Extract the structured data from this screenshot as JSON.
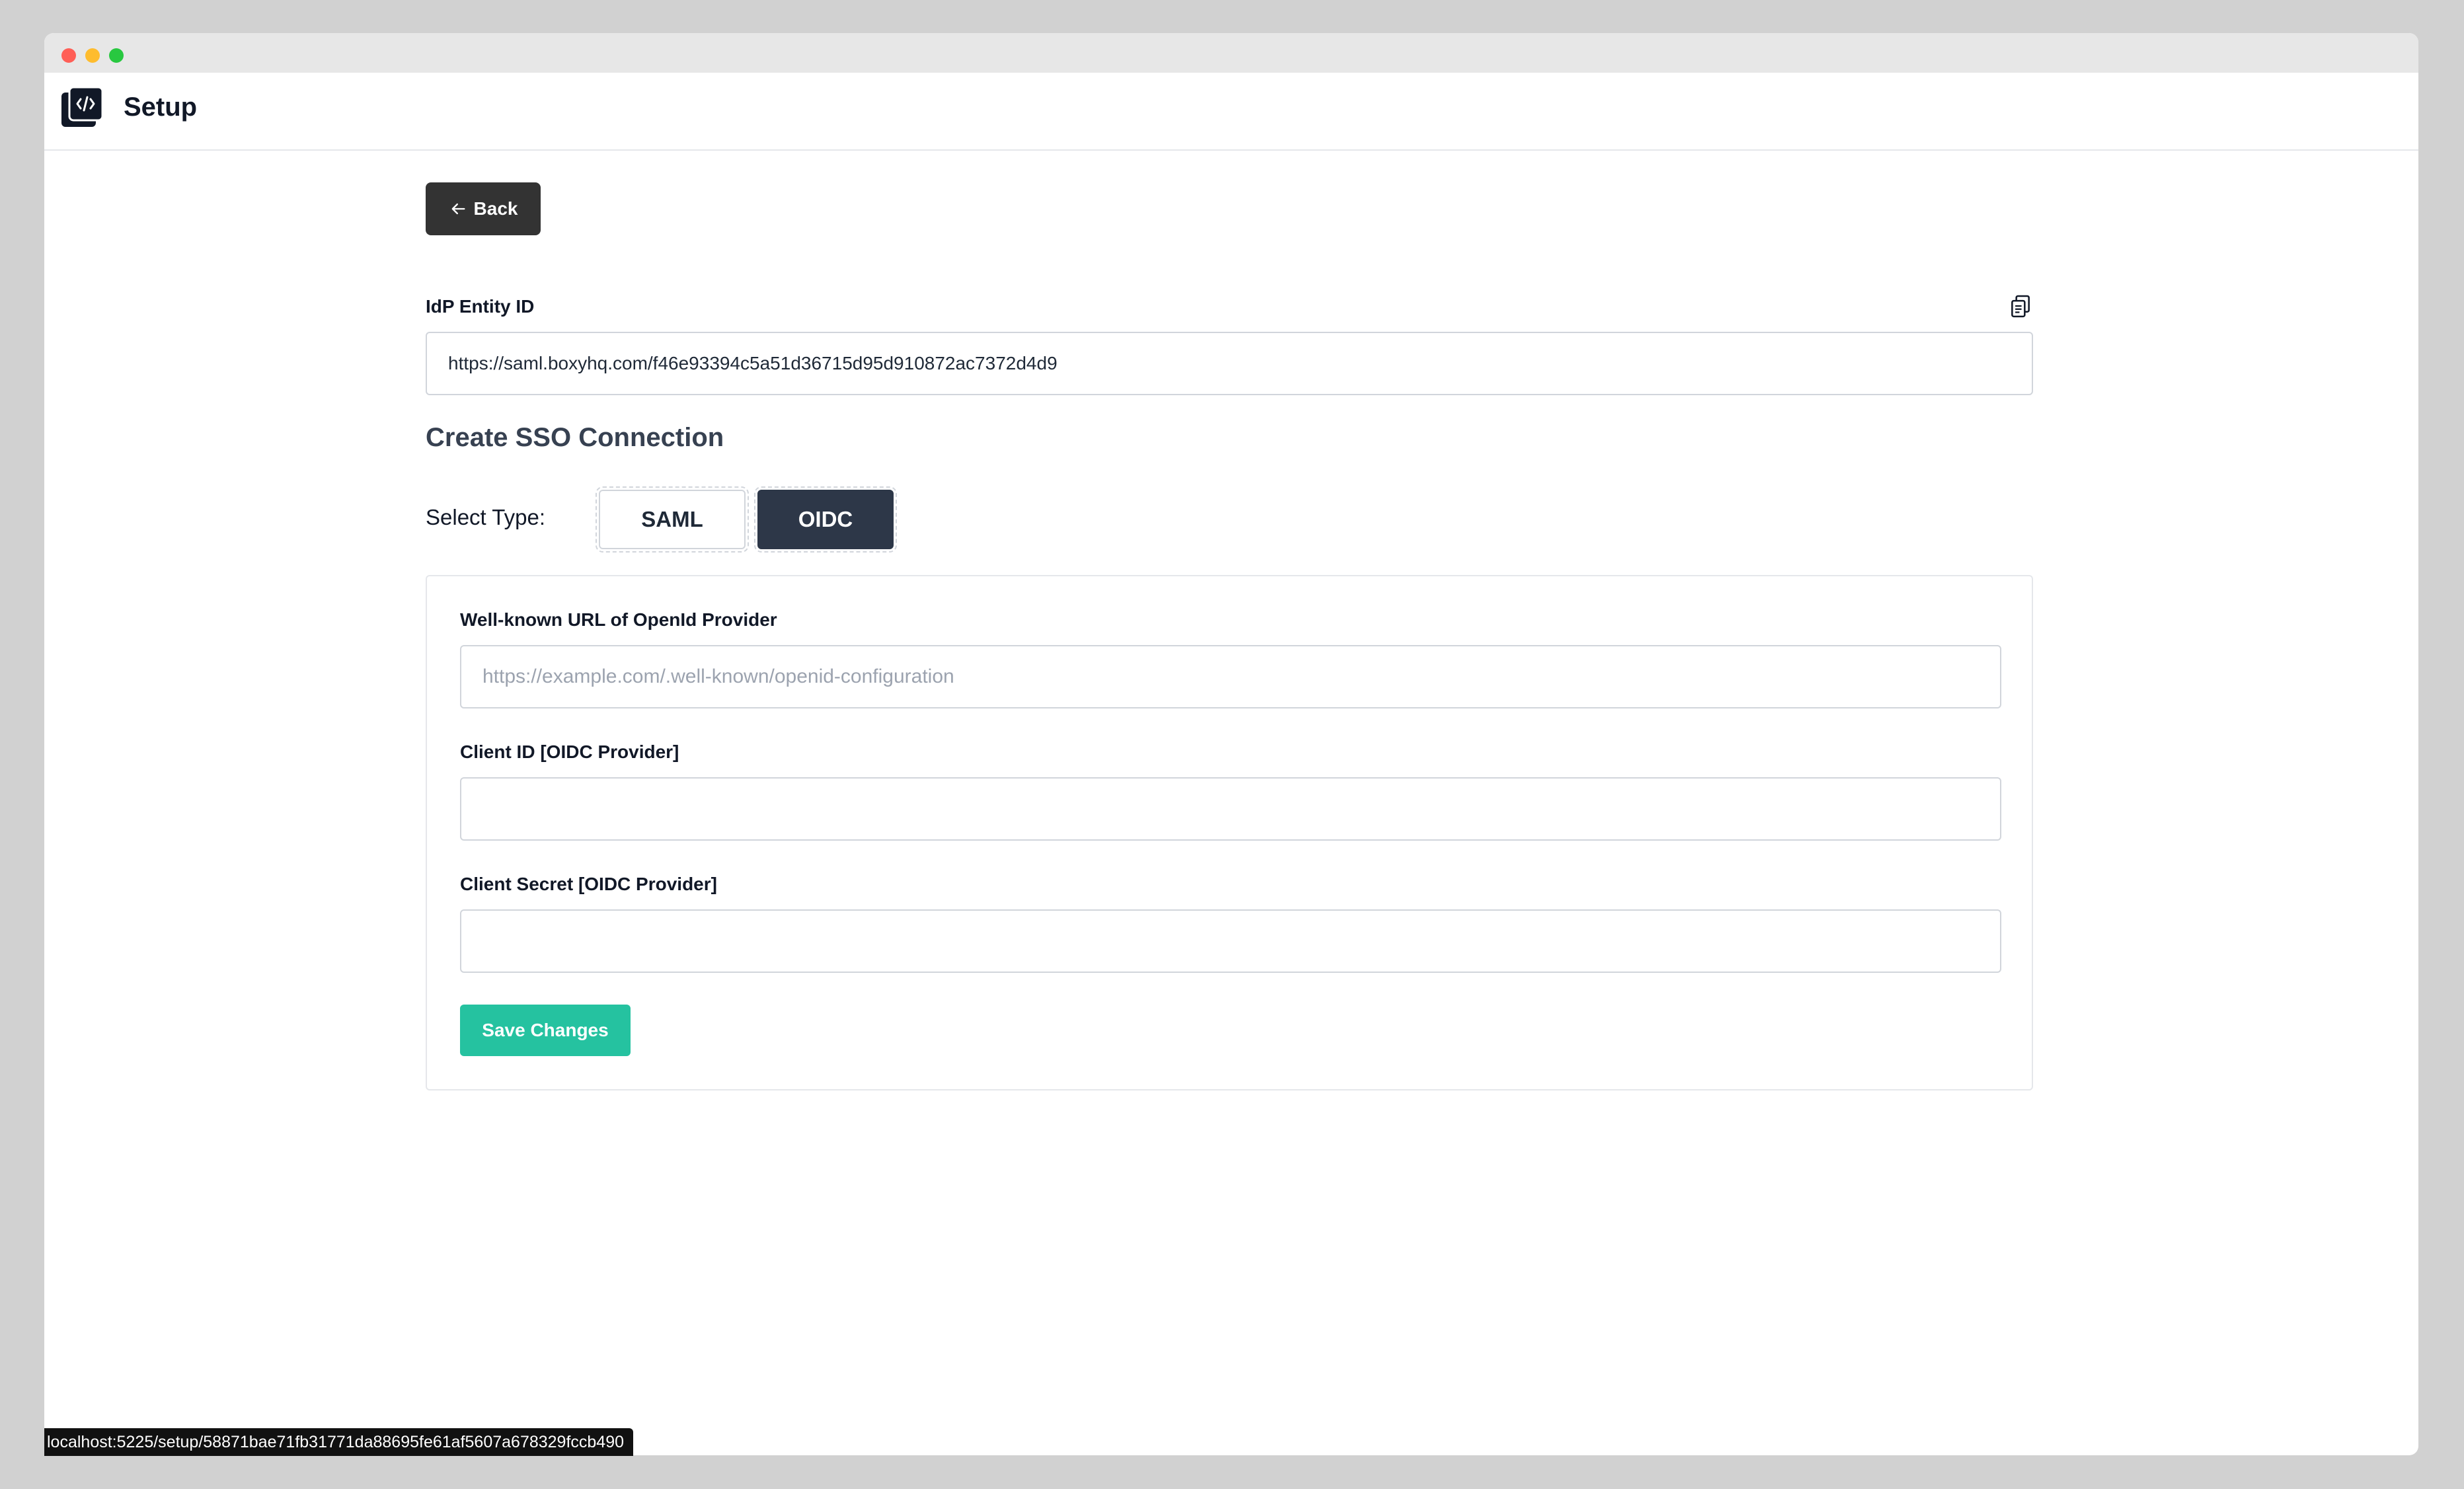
{
  "app": {
    "title": "Setup",
    "logo_icon": "code-logo-icon"
  },
  "back_button": {
    "label": "Back",
    "icon": "arrow-left-icon"
  },
  "idp": {
    "label": "IdP Entity ID",
    "value": "https://saml.boxyhq.com/f46e93394c5a51d36715d95d910872ac7372d4d9",
    "copy_icon": "clipboard-copy-icon"
  },
  "section": {
    "title": "Create SSO Connection"
  },
  "select_type": {
    "label": "Select Type:",
    "options": [
      "SAML",
      "OIDC"
    ],
    "selected": "OIDC"
  },
  "form": {
    "well_known": {
      "label": "Well-known URL of OpenId Provider",
      "placeholder": "https://example.com/.well-known/openid-configuration",
      "value": ""
    },
    "client_id": {
      "label": "Client ID [OIDC Provider]",
      "value": ""
    },
    "client_secret": {
      "label": "Client Secret [OIDC Provider]",
      "value": ""
    },
    "save_label": "Save Changes"
  },
  "status_bar": {
    "url": "localhost:5225/setup/58871bae71fb31771da88695fe61af5607a678329fccb490"
  },
  "colors": {
    "primary_dark": "#2d3748",
    "back_button": "#333333",
    "save_button": "#25c2a0"
  }
}
